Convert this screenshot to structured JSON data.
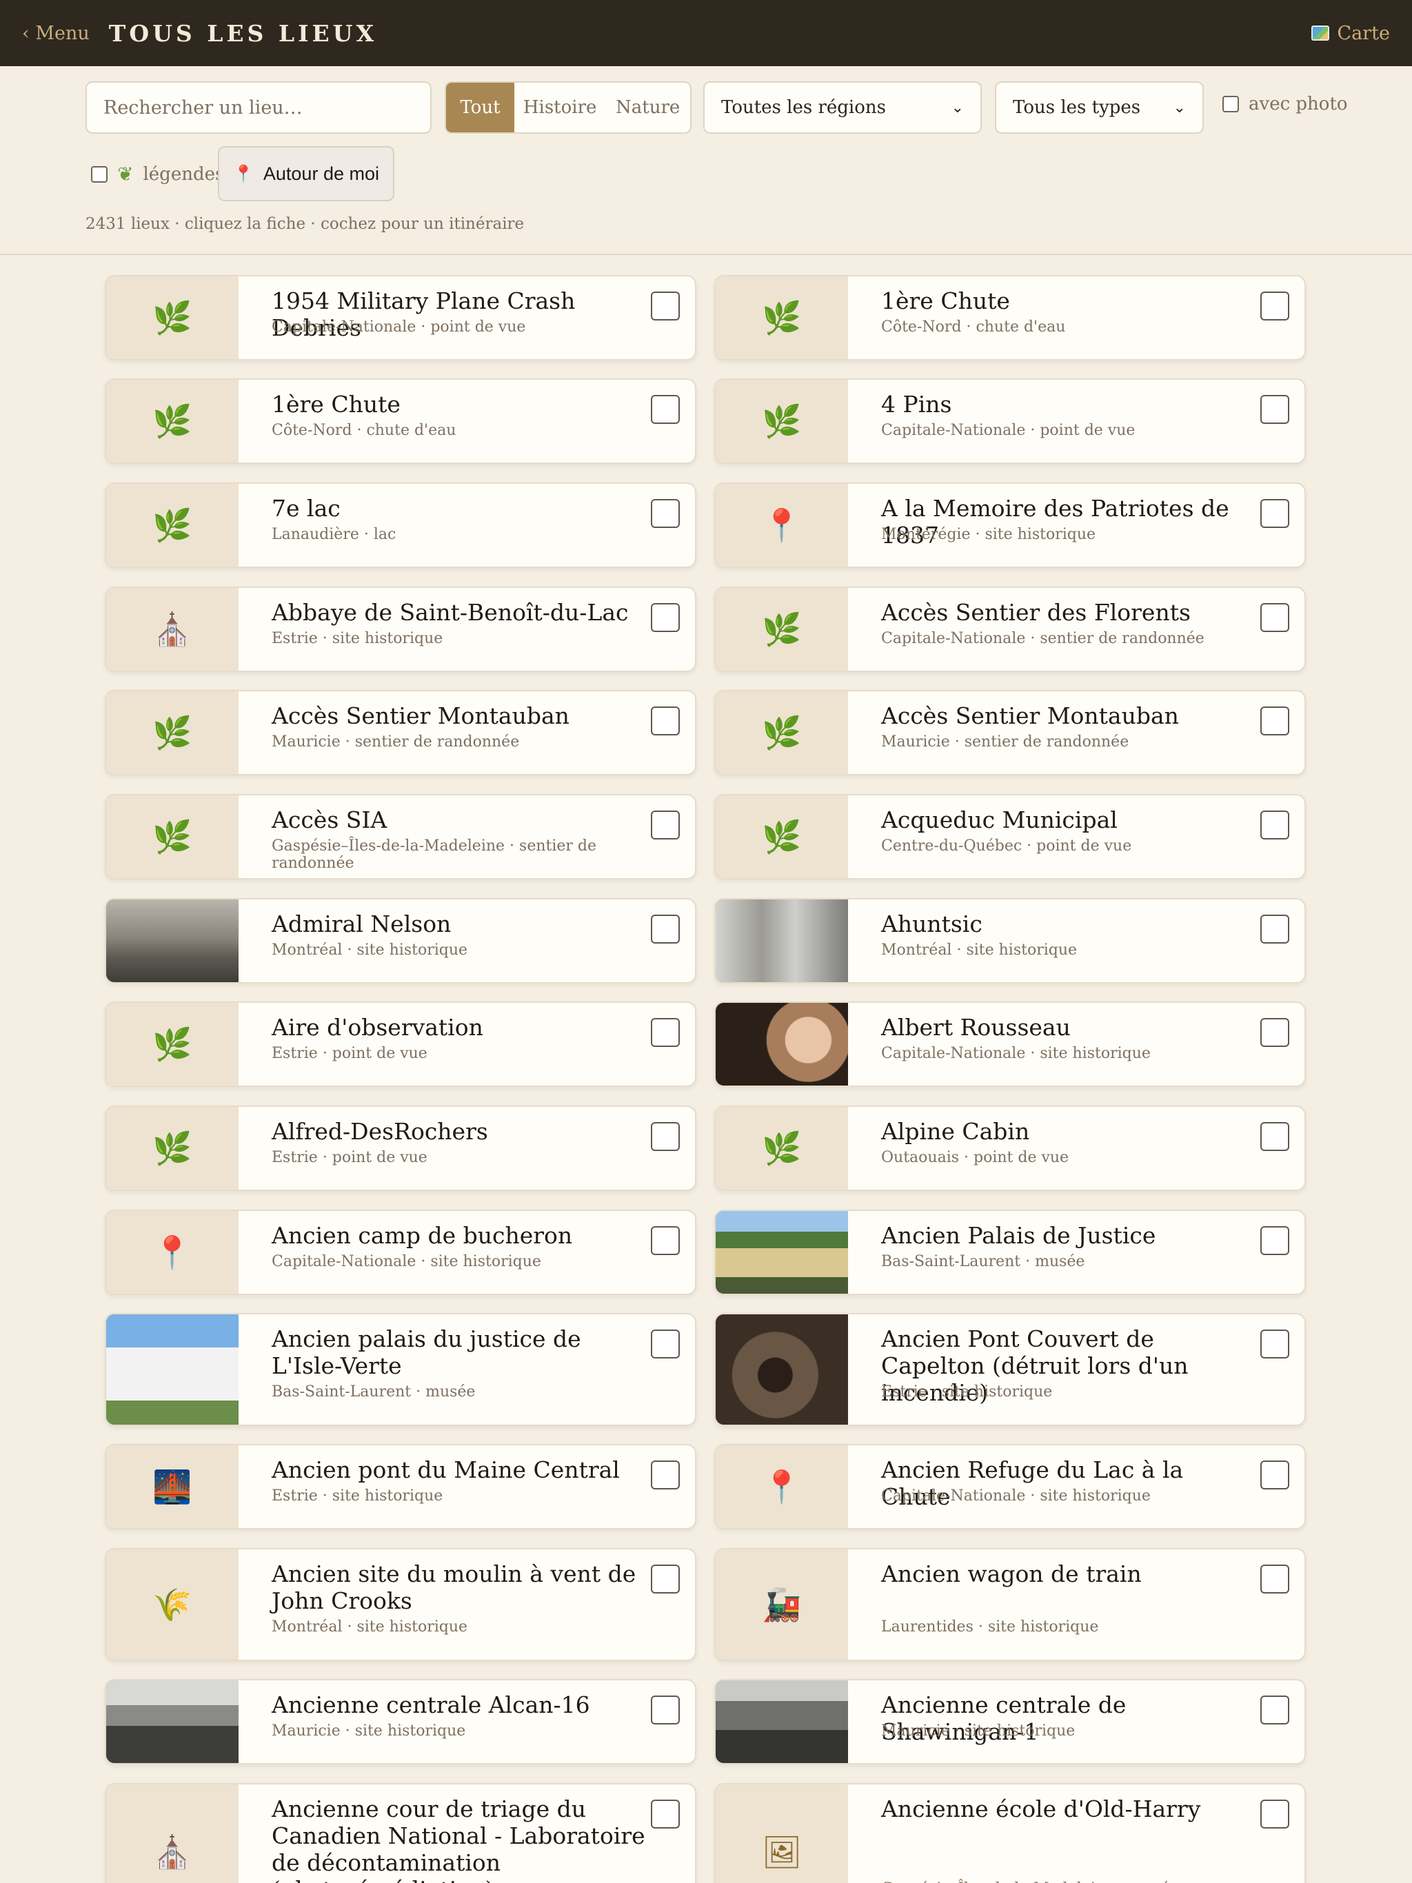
{
  "header": {
    "menu_label": "‹ Menu",
    "title": "TOUS LES LIEUX",
    "map_label": "Carte"
  },
  "filters": {
    "search_placeholder": "Rechercher un lieu…",
    "segments": [
      "Tout",
      "Histoire",
      "Nature"
    ],
    "active_segment": "Tout",
    "region_select": "Toutes les régions",
    "type_select": "Tous les types",
    "photo_label": "avec photo",
    "photo_checked": false,
    "legend_label": "légendes",
    "legend_checked": false,
    "near_button": "Autour de moi",
    "stats": "2431 lieux · cliquez la fiche · cochez pour un itinéraire"
  },
  "places": [
    {
      "name": "1954 Military Plane Crash Debries",
      "meta": "Capitale-Nationale · point de vue",
      "icon": "leaf-icon"
    },
    {
      "name": "1ère Chute",
      "meta": "Côte-Nord · chute d'eau",
      "icon": "leaf-icon"
    },
    {
      "name": "1ère Chute",
      "meta": "Côte-Nord · chute d'eau",
      "icon": "leaf-icon"
    },
    {
      "name": "4 Pins",
      "meta": "Capitale-Nationale · point de vue",
      "icon": "leaf-icon"
    },
    {
      "name": "7e lac",
      "meta": "Lanaudière · lac",
      "icon": "leaf-icon"
    },
    {
      "name": "A la Memoire des Patriotes de 1837",
      "meta": "Montérégie · site historique",
      "icon": "pin-icon"
    },
    {
      "name": "Abbaye de Saint-Benoît-du-Lac",
      "meta": "Estrie · site historique",
      "icon": "church-icon"
    },
    {
      "name": "Accès Sentier des Florents",
      "meta": "Capitale-Nationale · sentier de randonnée",
      "icon": "leaf-icon"
    },
    {
      "name": "Accès Sentier Montauban",
      "meta": "Mauricie · sentier de randonnée",
      "icon": "leaf-icon"
    },
    {
      "name": "Accès Sentier Montauban",
      "meta": "Mauricie · sentier de randonnée",
      "icon": "leaf-icon"
    },
    {
      "name": "Accès SIA",
      "meta": "Gaspésie–Îles-de-la-Madeleine · sentier de randonnée",
      "icon": "leaf-icon"
    },
    {
      "name": "Acqueduc Municipal",
      "meta": "Centre-du-Québec · point de vue",
      "icon": "leaf-icon"
    },
    {
      "name": "Admiral Nelson",
      "meta": "Montréal · site historique",
      "icon": "photo"
    },
    {
      "name": "Ahuntsic",
      "meta": "Montréal · site historique",
      "icon": "photo"
    },
    {
      "name": "Aire d'observation",
      "meta": "Estrie · point de vue",
      "icon": "leaf-icon"
    },
    {
      "name": "Albert Rousseau",
      "meta": "Capitale-Nationale · site historique",
      "icon": "photo"
    },
    {
      "name": "Alfred-DesRochers",
      "meta": "Estrie · point de vue",
      "icon": "leaf-icon"
    },
    {
      "name": "Alpine Cabin",
      "meta": "Outaouais · point de vue",
      "icon": "leaf-icon"
    },
    {
      "name": "Ancien camp de bucheron",
      "meta": "Capitale-Nationale · site historique",
      "icon": "pin-icon"
    },
    {
      "name": "Ancien Palais de Justice",
      "meta": "Bas-Saint-Laurent · musée",
      "icon": "photo"
    },
    {
      "name": "Ancien palais du justice de L'Isle-Verte",
      "meta": "Bas-Saint-Laurent · musée",
      "icon": "photo"
    },
    {
      "name": "Ancien Pont Couvert de Capelton (détruit lors d'un incendie)",
      "meta": "Estrie · site historique",
      "icon": "photo"
    },
    {
      "name": "Ancien pont du Maine Central",
      "meta": "Estrie · site historique",
      "icon": "bridge-icon"
    },
    {
      "name": "Ancien Refuge du Lac à la Chute",
      "meta": "Capitale-Nationale · site historique",
      "icon": "pin-icon"
    },
    {
      "name": "Ancien site du moulin à vent de John Crooks",
      "meta": "Montréal · site historique",
      "icon": "wheat-icon"
    },
    {
      "name": "Ancien wagon de train",
      "meta": "Laurentides · site historique",
      "icon": "train-icon"
    },
    {
      "name": "Ancienne centrale Alcan-16",
      "meta": "Mauricie · site historique",
      "icon": "photo"
    },
    {
      "name": "Ancienne centrale de Shawinigan-1",
      "meta": "Mauricie · site historique",
      "icon": "photo"
    },
    {
      "name": "Ancienne cour de triage du Canadien National - Laboratoire de décontamination (phytorémédiation)",
      "meta": "",
      "icon": "church-icon"
    },
    {
      "name": "Ancienne école d'Old-Harry",
      "meta": "Gaspésie–Îles-de-la-Madeleine · musée",
      "icon": "frame-icon"
    }
  ]
}
